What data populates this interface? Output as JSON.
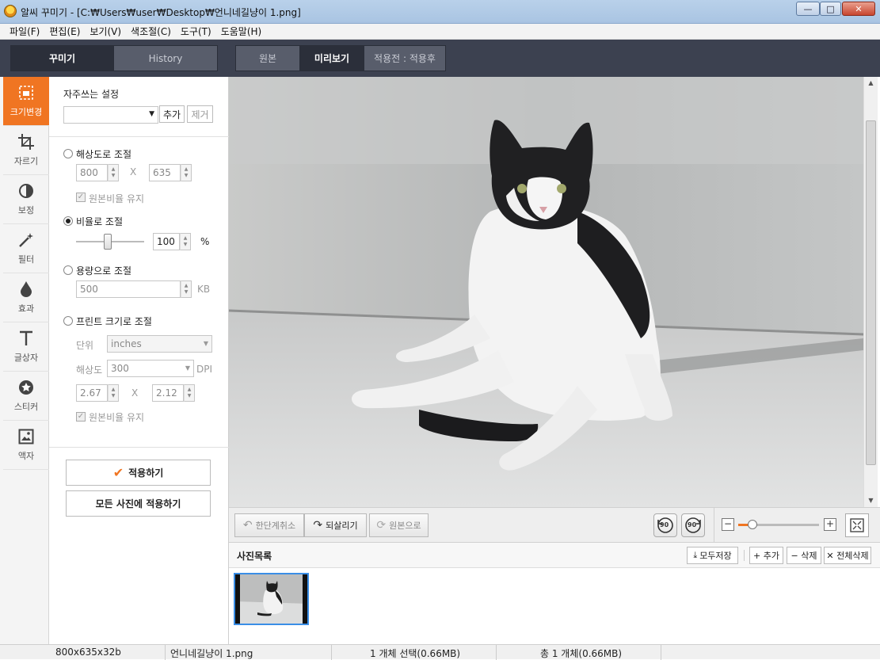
{
  "window": {
    "title": "알씨 꾸미기 - [C:₩Users₩user₩Desktop₩언니네길냥이 1.png]",
    "minimize_glyph": "—",
    "maximize_glyph": "□",
    "close_glyph": "✕"
  },
  "menu": [
    "파일(F)",
    "편집(E)",
    "보기(V)",
    "색조절(C)",
    "도구(T)",
    "도움말(H)"
  ],
  "panel_tabs": {
    "decorate": "꾸미기",
    "history": "History"
  },
  "view_tabs": {
    "original": "원본",
    "preview": "미리보기",
    "compare": "적용전 : 적용후"
  },
  "rail": [
    {
      "label": "크기변경",
      "icon": "resize-icon"
    },
    {
      "label": "자르기",
      "icon": "crop-icon"
    },
    {
      "label": "보정",
      "icon": "contrast-icon"
    },
    {
      "label": "필터",
      "icon": "magic-wand-icon"
    },
    {
      "label": "효과",
      "icon": "drop-icon"
    },
    {
      "label": "글상자",
      "icon": "text-icon"
    },
    {
      "label": "스티커",
      "icon": "star-icon"
    },
    {
      "label": "액자",
      "icon": "frame-icon"
    }
  ],
  "settings": {
    "presets_label": "자주쓰는 설정",
    "add": "추가",
    "remove": "제거",
    "by_resolution": "해상도로 조절",
    "width": "800",
    "height": "635",
    "x": "X",
    "keep_ratio": "원본비율 유지",
    "by_ratio": "비율로 조절",
    "ratio_value": "100",
    "percent": "%",
    "by_size": "용량으로 조절",
    "size_value": "500",
    "kb": "KB",
    "by_print": "프린트 크기로 조절",
    "unit_label": "단위",
    "unit_value": "inches",
    "res_label": "해상도",
    "res_value": "300",
    "dpi": "DPI",
    "print_w": "2.67",
    "print_h": "2.12",
    "keep_ratio2": "원본비율 유지",
    "apply": "적용하기",
    "apply_all": "모든 사진에 적용하기"
  },
  "toolbar": {
    "undo": "한단계취소",
    "redo": "되살리기",
    "revert": "원본으로",
    "rotate_left": "90",
    "rotate_right": "90",
    "zoom_minus": "−",
    "zoom_plus": "+",
    "zoom_level": 0.18
  },
  "photo_list": {
    "title": "사진목록",
    "save_all": "모두저장",
    "add": "+ 추가",
    "delete": "− 삭제",
    "delete_all": "✕ 전체삭제"
  },
  "status": {
    "dims": "800x635x32b",
    "filename": "언니네길냥이 1.png",
    "selected": "1 개체 선택(0.66MB)",
    "total": "총 1 개체(0.66MB)"
  },
  "colors": {
    "accent": "#f07522",
    "header_dark": "#3c4150"
  }
}
